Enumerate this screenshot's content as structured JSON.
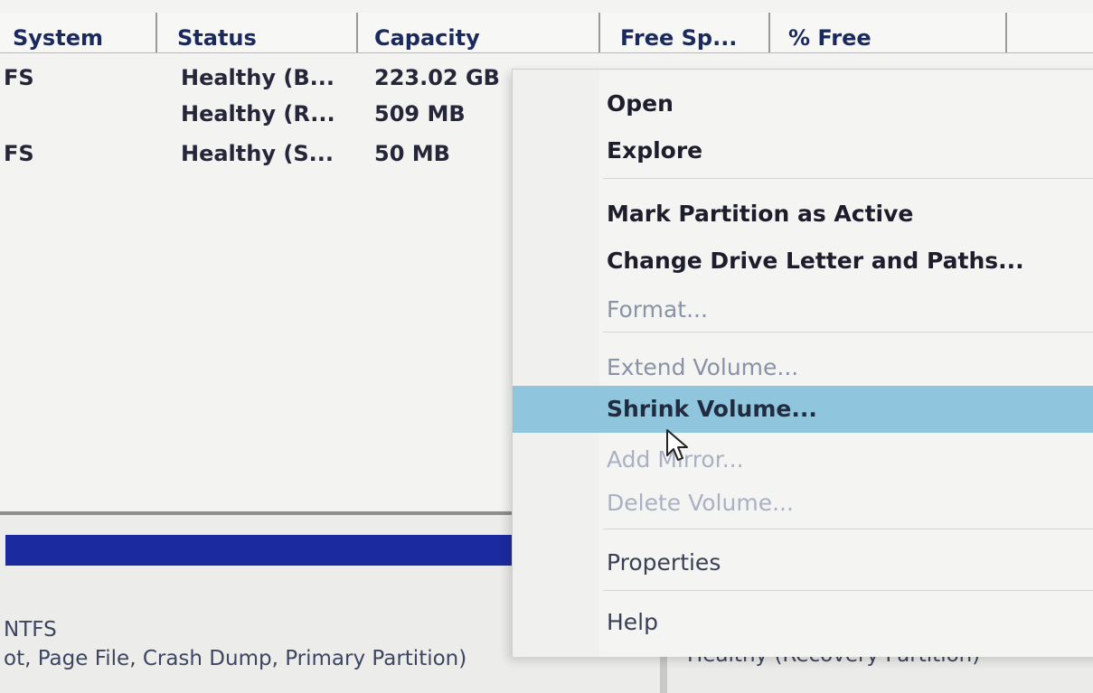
{
  "columns": [
    "System",
    "Status",
    "Capacity",
    "Free Sp...",
    "% Free"
  ],
  "rows": [
    {
      "fs": "FS",
      "status": "Healthy (B...",
      "capacity": "223.02 GB"
    },
    {
      "fs": "",
      "status": "Healthy (R...",
      "capacity": "509 MB"
    },
    {
      "fs": "FS",
      "status": "Healthy (S...",
      "capacity": "50 MB"
    }
  ],
  "graphical": {
    "fs_label": "NTFS",
    "partition_desc": "ot, Page File, Crash Dump, Primary Partition)",
    "recovery_desc": "Healthy (Recovery Partition)"
  },
  "context_menu": {
    "items": [
      {
        "label": "Open",
        "enabled": true
      },
      {
        "label": "Explore",
        "enabled": true
      },
      {
        "label": "Mark Partition as Active",
        "enabled": true
      },
      {
        "label": "Change Drive Letter and Paths...",
        "enabled": true
      },
      {
        "label": "Format...",
        "enabled": false
      },
      {
        "label": "Extend Volume...",
        "enabled": false
      },
      {
        "label": "Shrink Volume...",
        "enabled": true,
        "highlighted": true
      },
      {
        "label": "Add Mirror...",
        "enabled": false
      },
      {
        "label": "Delete Volume...",
        "enabled": false
      },
      {
        "label": "Properties",
        "enabled": true
      },
      {
        "label": "Help",
        "enabled": true
      }
    ]
  },
  "colors": {
    "highlight": "#8fc6dd",
    "volume_bar": "#1c2aa0",
    "header_text": "#1a2a5e",
    "disabled_text": "#8a93a6"
  }
}
